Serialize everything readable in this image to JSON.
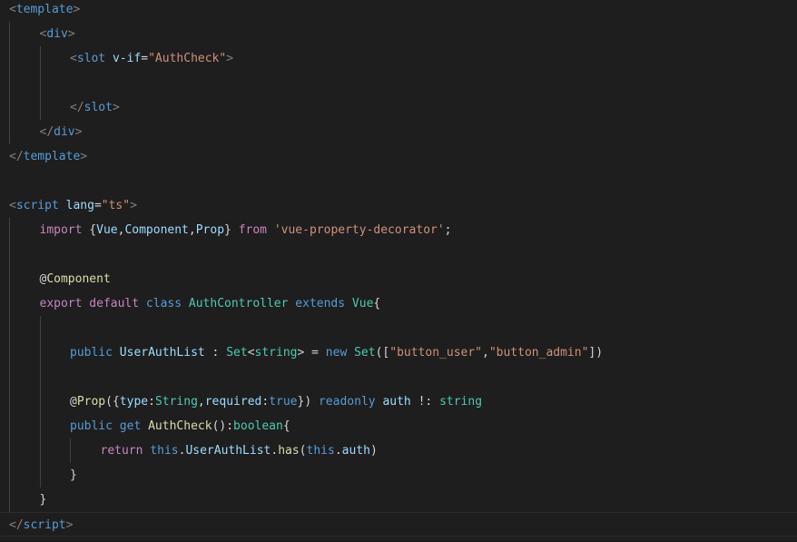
{
  "colors": {
    "background": "#1e1e1e",
    "tag_punctuation": "#808080",
    "tag": "#569cd6",
    "attribute": "#9cdcfe",
    "string": "#ce9178",
    "keyword_control": "#c586c0",
    "keyword": "#569cd6",
    "variable": "#9cdcfe",
    "type": "#4ec9b0",
    "function": "#dcdcaa",
    "text": "#d4d4d4",
    "indent_guide": "#404040"
  },
  "lines": [
    {
      "indent": 0,
      "tokens": [
        [
          "tag-punct",
          "<"
        ],
        [
          "tag",
          "template"
        ],
        [
          "tag-punct",
          ">"
        ]
      ]
    },
    {
      "indent": 1,
      "tokens": [
        [
          "tag-punct",
          "<"
        ],
        [
          "tag",
          "div"
        ],
        [
          "tag-punct",
          ">"
        ]
      ]
    },
    {
      "indent": 2,
      "tokens": [
        [
          "tag-punct",
          "<"
        ],
        [
          "tag",
          "slot"
        ],
        [
          "plain",
          " "
        ],
        [
          "attr",
          "v-if"
        ],
        [
          "plain",
          "="
        ],
        [
          "str",
          "\"AuthCheck\""
        ],
        [
          "tag-punct",
          ">"
        ]
      ]
    },
    {
      "indent": 0,
      "tokens": []
    },
    {
      "indent": 2,
      "tokens": [
        [
          "tag-punct",
          "</"
        ],
        [
          "tag",
          "slot"
        ],
        [
          "tag-punct",
          ">"
        ]
      ]
    },
    {
      "indent": 1,
      "tokens": [
        [
          "tag-punct",
          "</"
        ],
        [
          "tag",
          "div"
        ],
        [
          "tag-punct",
          ">"
        ]
      ]
    },
    {
      "indent": 0,
      "tokens": [
        [
          "tag-punct",
          "</"
        ],
        [
          "tag",
          "template"
        ],
        [
          "tag-punct",
          ">"
        ]
      ]
    },
    {
      "indent": 0,
      "tokens": []
    },
    {
      "indent": 0,
      "tokens": [
        [
          "tag-punct",
          "<"
        ],
        [
          "tag",
          "script"
        ],
        [
          "plain",
          " "
        ],
        [
          "attr",
          "lang"
        ],
        [
          "plain",
          "="
        ],
        [
          "str",
          "\"ts\""
        ],
        [
          "tag-punct",
          ">"
        ]
      ]
    },
    {
      "indent": 1,
      "tokens": [
        [
          "kw-ctrl",
          "import"
        ],
        [
          "plain",
          " {"
        ],
        [
          "var",
          "Vue"
        ],
        [
          "plain",
          ","
        ],
        [
          "var",
          "Component"
        ],
        [
          "plain",
          ","
        ],
        [
          "var",
          "Prop"
        ],
        [
          "plain",
          "} "
        ],
        [
          "kw-ctrl",
          "from"
        ],
        [
          "plain",
          " "
        ],
        [
          "str",
          "'vue-property-decorator'"
        ],
        [
          "plain",
          ";"
        ]
      ]
    },
    {
      "indent": 0,
      "tokens": []
    },
    {
      "indent": 1,
      "tokens": [
        [
          "plain",
          "@"
        ],
        [
          "fn",
          "Component"
        ]
      ]
    },
    {
      "indent": 1,
      "tokens": [
        [
          "kw-ctrl",
          "export"
        ],
        [
          "plain",
          " "
        ],
        [
          "kw-ctrl",
          "default"
        ],
        [
          "plain",
          " "
        ],
        [
          "kw",
          "class"
        ],
        [
          "plain",
          " "
        ],
        [
          "type",
          "AuthController"
        ],
        [
          "plain",
          " "
        ],
        [
          "kw",
          "extends"
        ],
        [
          "plain",
          " "
        ],
        [
          "type",
          "Vue"
        ],
        [
          "plain",
          "{"
        ]
      ]
    },
    {
      "indent": 0,
      "tokens": []
    },
    {
      "indent": 2,
      "tokens": [
        [
          "kw",
          "public"
        ],
        [
          "plain",
          " "
        ],
        [
          "var",
          "UserAuthList"
        ],
        [
          "plain",
          " : "
        ],
        [
          "type",
          "Set"
        ],
        [
          "plain",
          "<"
        ],
        [
          "type",
          "string"
        ],
        [
          "plain",
          "> = "
        ],
        [
          "kw",
          "new"
        ],
        [
          "plain",
          " "
        ],
        [
          "type",
          "Set"
        ],
        [
          "plain",
          "(["
        ],
        [
          "str",
          "\"button_user\""
        ],
        [
          "plain",
          ","
        ],
        [
          "str",
          "\"button_admin\""
        ],
        [
          "plain",
          "])"
        ]
      ]
    },
    {
      "indent": 0,
      "tokens": []
    },
    {
      "indent": 2,
      "tokens": [
        [
          "plain",
          "@"
        ],
        [
          "fn",
          "Prop"
        ],
        [
          "plain",
          "({"
        ],
        [
          "var",
          "type"
        ],
        [
          "plain",
          ":"
        ],
        [
          "type",
          "String"
        ],
        [
          "plain",
          ","
        ],
        [
          "var",
          "required"
        ],
        [
          "plain",
          ":"
        ],
        [
          "kw",
          "true"
        ],
        [
          "plain",
          "}) "
        ],
        [
          "kw",
          "readonly"
        ],
        [
          "plain",
          " "
        ],
        [
          "var",
          "auth"
        ],
        [
          "plain",
          " !: "
        ],
        [
          "type",
          "string"
        ]
      ]
    },
    {
      "indent": 2,
      "tokens": [
        [
          "kw",
          "public"
        ],
        [
          "plain",
          " "
        ],
        [
          "kw",
          "get"
        ],
        [
          "plain",
          " "
        ],
        [
          "fn",
          "AuthCheck"
        ],
        [
          "plain",
          "():"
        ],
        [
          "type",
          "boolean"
        ],
        [
          "plain",
          "{"
        ]
      ]
    },
    {
      "indent": 3,
      "tokens": [
        [
          "kw-ctrl",
          "return"
        ],
        [
          "plain",
          " "
        ],
        [
          "kw",
          "this"
        ],
        [
          "plain",
          "."
        ],
        [
          "var",
          "UserAuthList"
        ],
        [
          "plain",
          "."
        ],
        [
          "fn",
          "has"
        ],
        [
          "plain",
          "("
        ],
        [
          "kw",
          "this"
        ],
        [
          "plain",
          "."
        ],
        [
          "var",
          "auth"
        ],
        [
          "plain",
          ")"
        ]
      ]
    },
    {
      "indent": 2,
      "tokens": [
        [
          "plain",
          "}"
        ]
      ]
    },
    {
      "indent": 1,
      "tokens": [
        [
          "plain",
          "}"
        ]
      ]
    },
    {
      "indent": 0,
      "tokens": [
        [
          "tag-punct",
          "</"
        ],
        [
          "tag",
          "script"
        ],
        [
          "tag-punct",
          ">"
        ]
      ]
    }
  ]
}
